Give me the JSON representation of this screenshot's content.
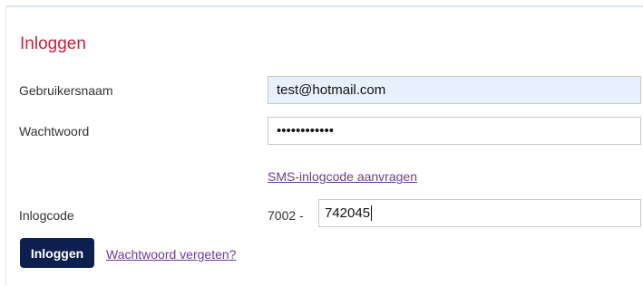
{
  "form": {
    "title": "Inloggen",
    "username": {
      "label": "Gebruikersnaam",
      "value": "test@hotmail.com"
    },
    "password": {
      "label": "Wachtwoord",
      "masked_value": "••••••••••••"
    },
    "sms_link": "SMS-inlogcode aanvragen",
    "login_code": {
      "label": "Inlogcode",
      "prefix": "7002 -",
      "value": "742045"
    },
    "submit_label": "Inloggen",
    "forgot_link": "Wachtwoord vergeten?"
  },
  "colors": {
    "title": "#c8203a",
    "button_bg": "#0d1f4f",
    "link": "#6e3aa0",
    "autofill_bg": "#e8f0fe"
  }
}
